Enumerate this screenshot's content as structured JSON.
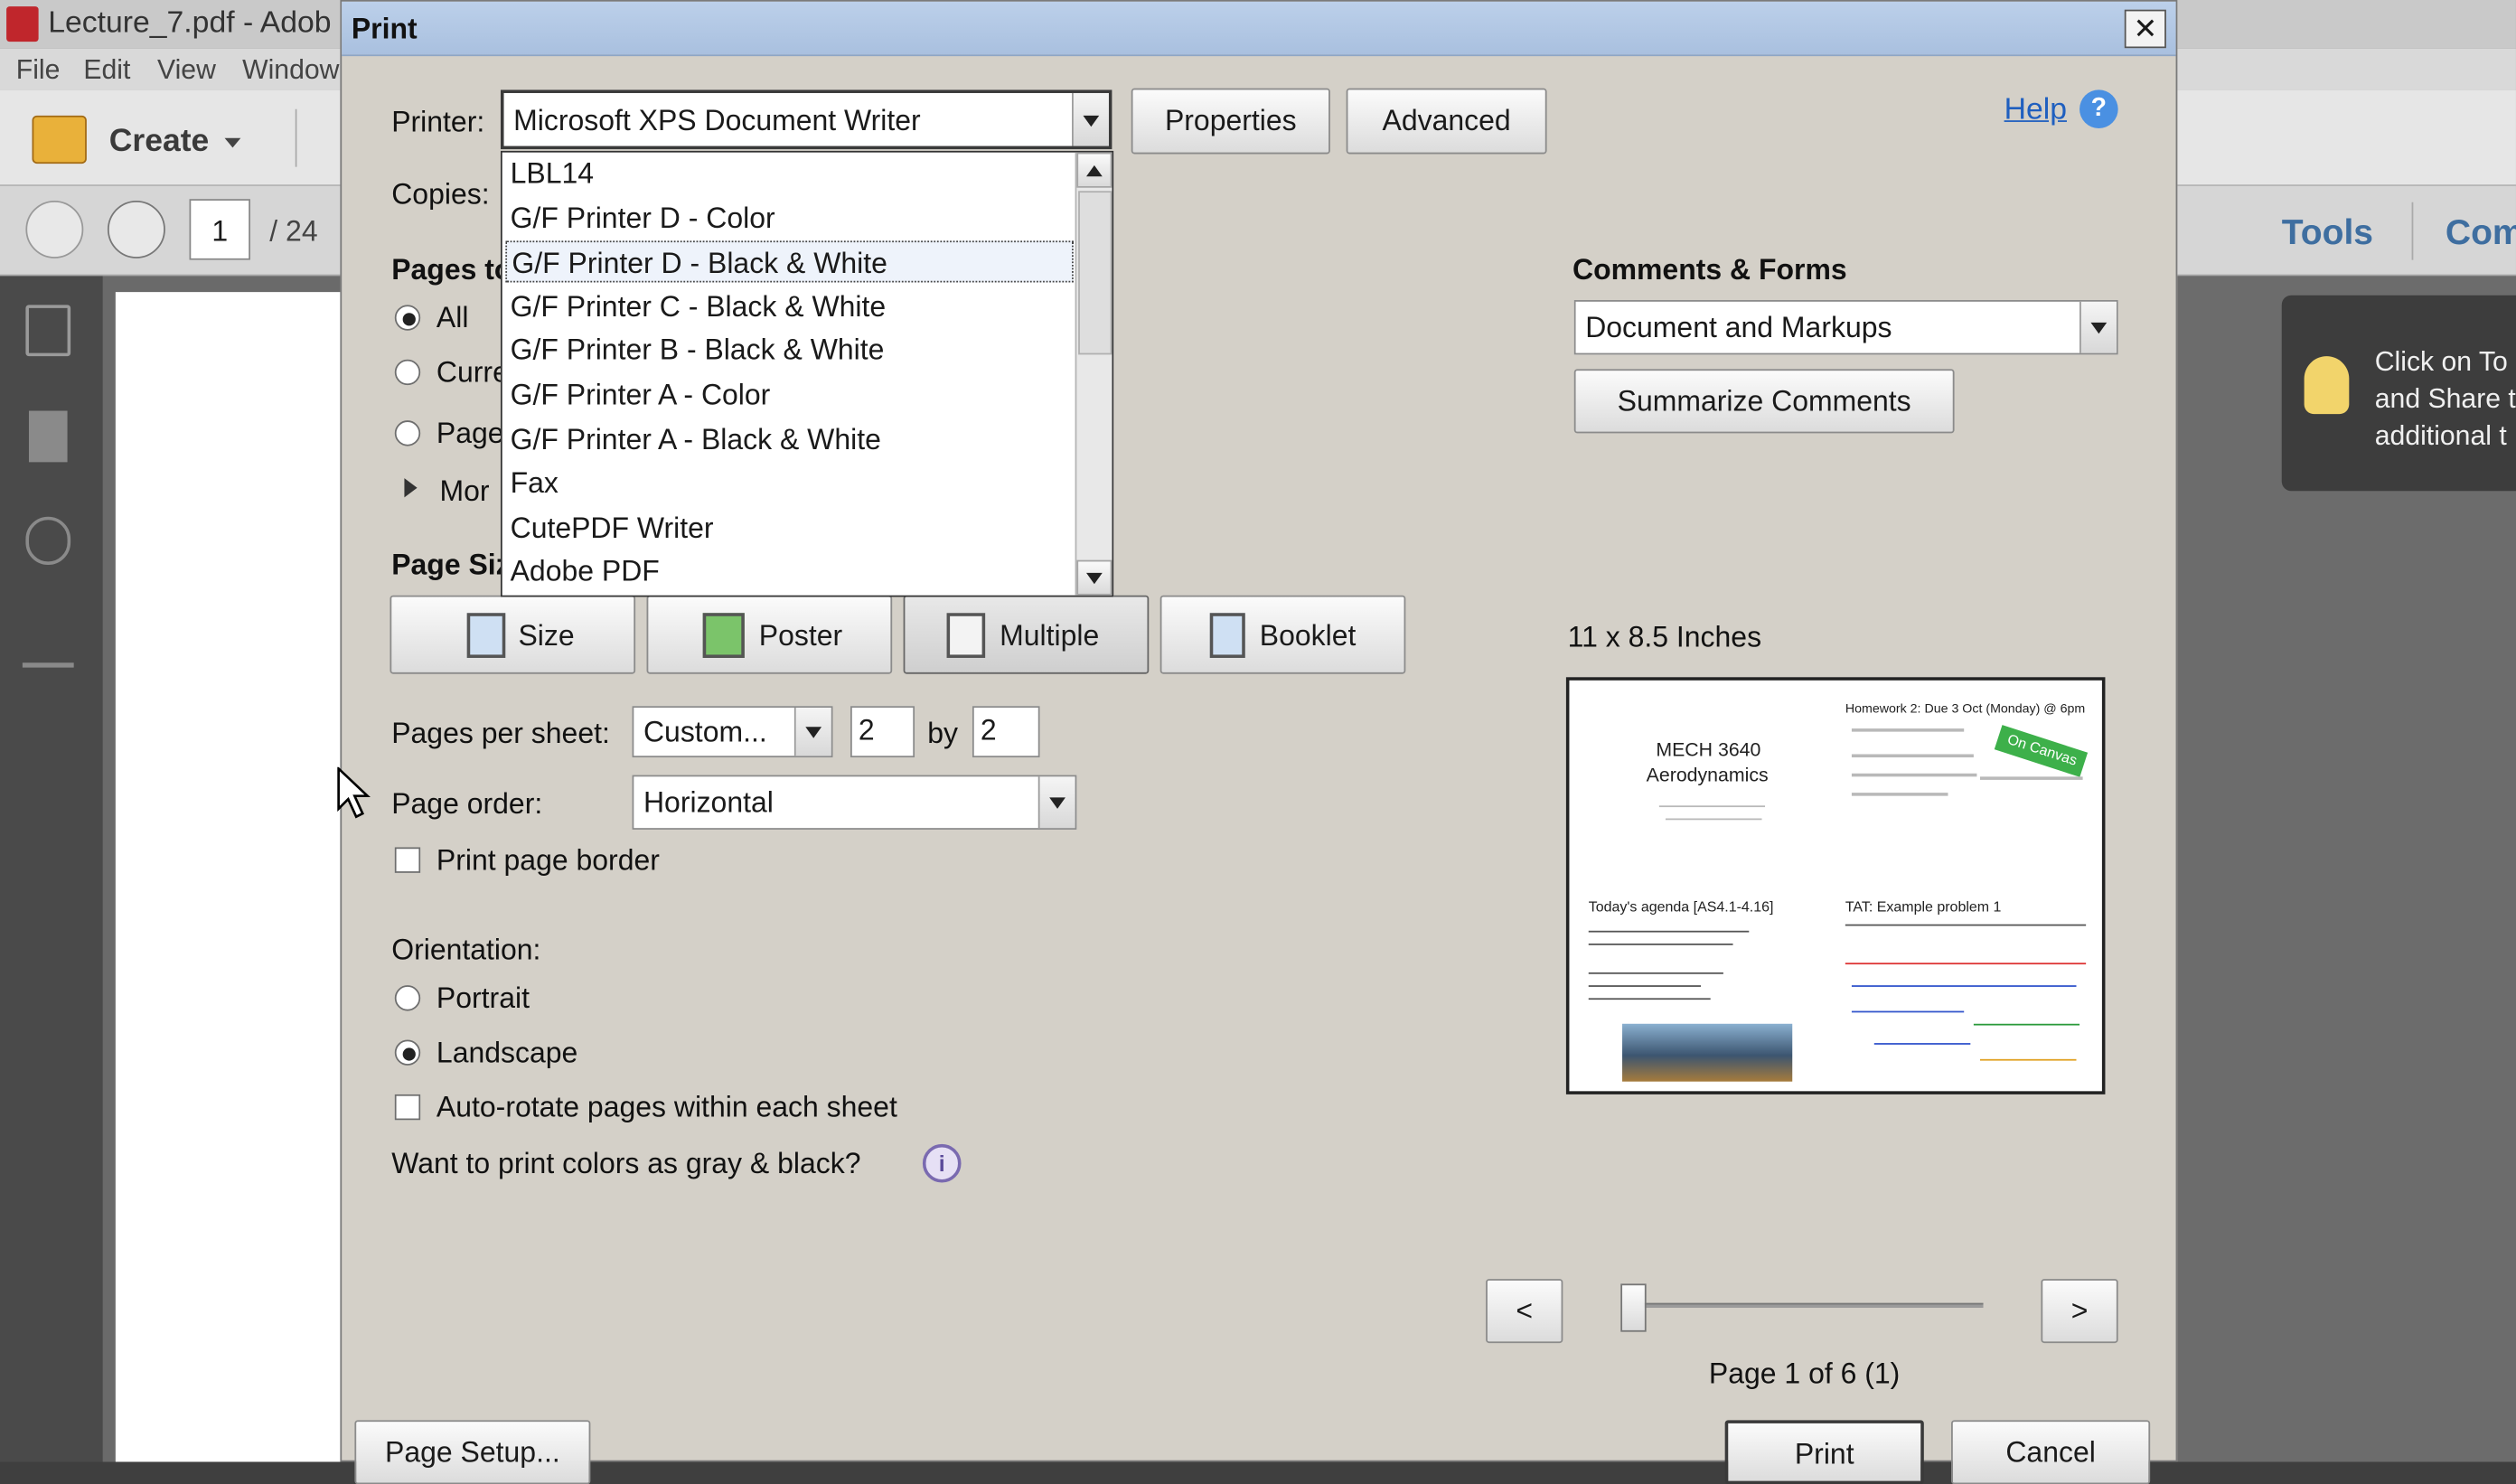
{
  "app": {
    "title": "Lecture_7.pdf - Adob",
    "menu": [
      "File",
      "Edit",
      "View",
      "Window"
    ],
    "create_label": "Create",
    "page_current": "1",
    "page_total": "/ 24",
    "tools_label": "Tools",
    "comment_label": "Com",
    "tooltip_lines": [
      "Click on To",
      "and Share t",
      "additional t"
    ]
  },
  "dialog": {
    "title": "Print",
    "close_label": "✕",
    "printer_label": "Printer:",
    "printer_value": "Microsoft XPS Document Writer",
    "properties_label": "Properties",
    "advanced_label": "Advanced",
    "help_label": "Help",
    "copies_label": "Copies:",
    "pages_to_print_label": "Pages to",
    "pages_all": "All",
    "pages_current": "Curre",
    "pages_range": "Page",
    "more_options": "Mor",
    "page_sizing_label": "Page Siz",
    "mode_buttons": [
      "Size",
      "Poster",
      "Multiple",
      "Booklet"
    ],
    "pages_per_sheet_label": "Pages per sheet:",
    "pages_per_sheet_value": "Custom...",
    "pps_x": "2",
    "by_label": "by",
    "pps_y": "2",
    "page_order_label": "Page order:",
    "page_order_value": "Horizontal",
    "print_border_label": "Print page border",
    "orientation_label": "Orientation:",
    "portrait_label": "Portrait",
    "landscape_label": "Landscape",
    "autorotate_label": "Auto-rotate pages within each sheet",
    "gray_label": "Want to print colors as gray & black?",
    "comments_forms_label": "Comments & Forms",
    "comments_value": "Document and Markups",
    "summarize_label": "Summarize Comments",
    "paper_size": "11 x 8.5 Inches",
    "prev_label": "<",
    "next_label": ">",
    "page_indicator": "Page 1 of 6 (1)",
    "page_setup_label": "Page Setup...",
    "print_label": "Print",
    "cancel_label": "Cancel"
  },
  "printer_list": [
    "LBL14",
    "G/F Printer D - Color",
    "G/F Printer D - Black & White",
    "G/F Printer C - Black & White",
    "G/F Printer B - Black & White",
    "G/F Printer A - Color",
    "G/F Printer A - Black & White",
    "Fax",
    "CutePDF Writer",
    "Adobe PDF"
  ],
  "printer_list_selected_index": 2,
  "preview": {
    "slide1_title": "MECH 3640",
    "slide1_sub": "Aerodynamics",
    "slide2_title": "Homework 2: Due 3 Oct (Monday) @ 6pm",
    "slide2_badge": "On Canvas",
    "slide3_title": "Today's agenda [AS4.1-4.16]",
    "slide4_title": "TAT: Example problem 1"
  },
  "colors": {
    "accent": "#1f5fbf",
    "dialog_bg": "#d4d0c8"
  }
}
